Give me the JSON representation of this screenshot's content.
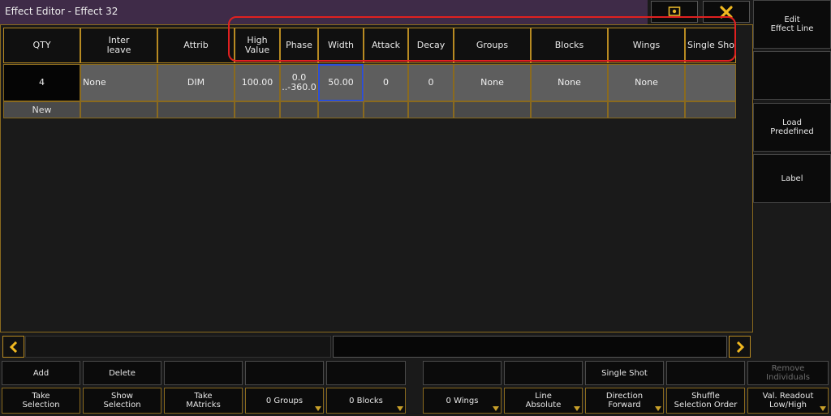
{
  "window": {
    "title": "Effect Editor - Effect 32"
  },
  "table": {
    "headers": [
      "QTY",
      "Inter\nleave",
      "Attrib",
      "High\nValue",
      "Phase",
      "Width",
      "Attack",
      "Decay",
      "Groups",
      "Blocks",
      "Wings",
      "Single Sho"
    ],
    "row": [
      "4",
      "None",
      "DIM",
      "100.00",
      "0.0\n..-360.0",
      "50.00",
      "0",
      "0",
      "None",
      "None",
      "None",
      ""
    ],
    "new_label": "New"
  },
  "side": {
    "edit": "Edit\nEffect Line",
    "load": "Load\nPredefined",
    "label": "Label"
  },
  "bottom": {
    "row1": {
      "add": "Add",
      "delete": "Delete",
      "single_shot": "Single Shot",
      "remove": "Remove\nIndividuals"
    },
    "row2": {
      "take_selection": "Take\nSelection",
      "show_selection": "Show\nSelection",
      "take_matricks": "Take\nMAtricks",
      "groups": "0 Groups",
      "blocks": "0 Blocks",
      "wings": "0 Wings",
      "line": "Line\nAbsolute",
      "direction": "Direction\nForward",
      "shuffle": "Shuffle\nSelection Order",
      "readout": "Val. Readout\nLow/High"
    }
  },
  "colors": {
    "accent": "#b78a22",
    "highlight": "#e02020",
    "title_bar": "#3f2b48",
    "active_cell_border": "#2b4fd8"
  }
}
